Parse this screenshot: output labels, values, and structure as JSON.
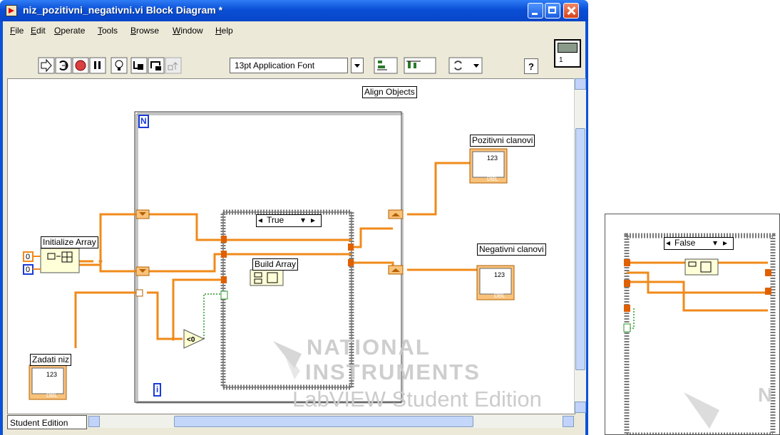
{
  "window": {
    "title": "niz_pozitivni_negativni.vi Block Diagram *",
    "title_color": "#ffffff",
    "titlebar_color": "#0a4fd6"
  },
  "menu": [
    "File",
    "Edit",
    "Operate",
    "Tools",
    "Browse",
    "Window",
    "Help"
  ],
  "toolbar": {
    "font_selector": "13pt Application Font",
    "buttons": [
      "run-arrow-icon",
      "run-continuously-icon",
      "abort-icon",
      "pause-icon",
      "highlight-execution-icon",
      "step-into-icon",
      "step-over-icon",
      "step-out-icon",
      "align-objects-icon",
      "distribute-objects-icon",
      "reorder-icon",
      "context-help-icon"
    ],
    "context_help": "?"
  },
  "vi_icon": {
    "label": "1"
  },
  "tooltip": "Align Objects",
  "diagram": {
    "for_loop": {
      "count_terminal": "N",
      "iteration_terminal": "i"
    },
    "case_structure": {
      "selector": "True"
    },
    "nodes": {
      "initialize_array": "Initialize Array",
      "build_array": "Build Array",
      "zadati_niz": "Zadati niz",
      "pozitivni": "Pozitivni clanovi",
      "negativni": "Negativni clanovi",
      "compare": "<0",
      "constant_top": "0",
      "constant_bottom": "0",
      "indicator_type": "123",
      "dbl": "DBL"
    },
    "wire_color": "#f08a1a"
  },
  "status": {
    "edition_label": "Student Edition"
  },
  "watermark": {
    "line1": "NATIONAL",
    "line2": "INSTRUMENTS",
    "line3": "LabVIEW Student Edition"
  },
  "right_panel": {
    "selector": "False",
    "watermark": "N"
  }
}
